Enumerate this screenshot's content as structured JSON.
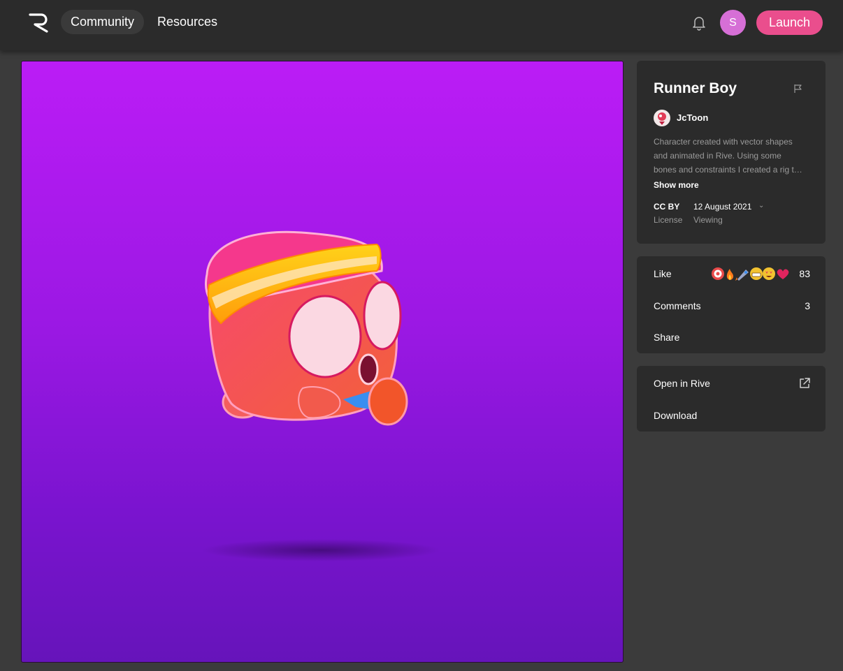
{
  "header": {
    "logo_icon": "rive-logo-icon",
    "nav": {
      "community": "Community",
      "resources": "Resources"
    },
    "notifications_icon": "bell-icon",
    "user_initial": "S",
    "launch_label": "Launch",
    "colors": {
      "bar": "#2b2b2b",
      "launch": "#ea4e8d",
      "avatar": "#d66fd6"
    }
  },
  "canvas": {
    "background_top": "#bb1cf6",
    "background_bottom": "#6614ba"
  },
  "info": {
    "title": "Runner Boy",
    "flag_icon": "flag-icon",
    "author": "JcToon",
    "description_lines": [
      "Character created with vector shapes",
      "and animated in Rive. Using some",
      "bones and constraints I created a rig t…"
    ],
    "show_more": "Show more",
    "license_value": "CC BY",
    "license_label": "License",
    "date_value": "12 August 2021",
    "date_label": "Viewing",
    "chevron_icon": "chevron-down-icon"
  },
  "social": {
    "like_label": "Like",
    "like_count": "83",
    "reaction_icons": [
      "target-emoji",
      "fire-emoji",
      "rocket-emoji",
      "grimace-emoji",
      "heart-eyes-emoji",
      "heart-emoji"
    ],
    "comments_label": "Comments",
    "comments_count": "3",
    "share_label": "Share"
  },
  "actions": {
    "open_label": "Open in Rive",
    "open_icon": "external-link-icon",
    "download_label": "Download"
  }
}
